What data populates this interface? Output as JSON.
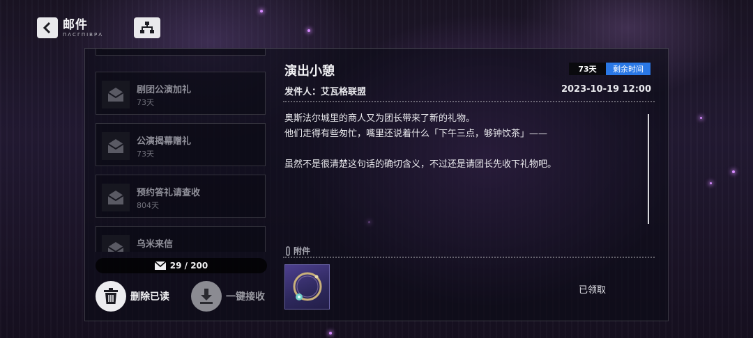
{
  "header": {
    "title": "邮件",
    "subtitle": "ΠΛCΓΠΙΒΡΛ"
  },
  "mail_list": [
    {
      "name": "",
      "days": ""
    },
    {
      "name": "剧团公演加礼",
      "days": "73天"
    },
    {
      "name": "公演揭幕赠礼",
      "days": "73天"
    },
    {
      "name": "预约答礼请查收",
      "days": "804天"
    },
    {
      "name": "乌米来信",
      "days": ""
    }
  ],
  "counter": {
    "text": "29 / 200"
  },
  "actions": {
    "delete_read": "删除已读",
    "receive_all": "一键接收"
  },
  "detail": {
    "title": "演出小憩",
    "days_badge": "73天",
    "remaining_label": "剩余时间",
    "sender": "发件人：艾瓦格联盟",
    "datetime": "2023-10-19 12:00",
    "body": [
      "奥斯法尔城里的商人又为团长带来了新的礼物。",
      "他们走得有些匆忙，嘴里还说着什么「下午三点，够钟饮茶」——",
      "",
      "虽然不是很清楚这句话的确切含义，不过还是请团长先收下礼物吧。"
    ],
    "attachment_label": "附件",
    "claimed_label": "已领取"
  },
  "colors": {
    "accent_blue": "#2a78e6",
    "panel_bg": "#0c0c16",
    "item_frame": "#6a64a8"
  }
}
